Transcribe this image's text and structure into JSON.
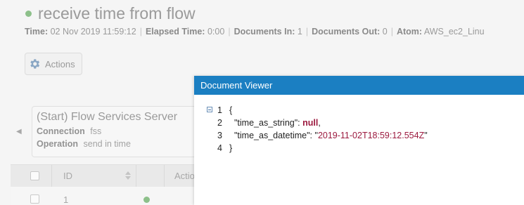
{
  "process": {
    "title": "receive time from flow",
    "meta": [
      {
        "label": "Time:",
        "value": "02 Nov 2019 11:59:12"
      },
      {
        "label": "Elapsed Time:",
        "value": "0:00"
      },
      {
        "label": "Documents In:",
        "value": "1"
      },
      {
        "label": "Documents Out:",
        "value": "0"
      },
      {
        "label": "Atom:",
        "value": "AWS_ec2_Linu"
      }
    ],
    "actions_label": "Actions"
  },
  "shape": {
    "title": "(Start) Flow Services Server",
    "connection_label": "Connection",
    "connection_value": "fss",
    "operation_label": "Operation",
    "operation_value": "send in time"
  },
  "grid": {
    "columns": [
      "ID",
      "Actio"
    ],
    "rows": [
      {
        "id": "1"
      }
    ]
  },
  "viewer": {
    "title": "Document Viewer",
    "lines": [
      {
        "n": "1",
        "open": "{"
      },
      {
        "n": "2",
        "key": "\"time_as_string\"",
        "sep": ": ",
        "value": "null",
        "end": ","
      },
      {
        "n": "3",
        "key": "\"time_as_datetime\"",
        "sep": ": \"",
        "value": "2019-11-02T18:59:12.554Z",
        "end": "\""
      },
      {
        "n": "4",
        "close": "}"
      }
    ]
  },
  "colors": {
    "header_blue": "#1b7fc2",
    "status_green": "#8dc08a",
    "json_value": "#9c1a3f"
  }
}
